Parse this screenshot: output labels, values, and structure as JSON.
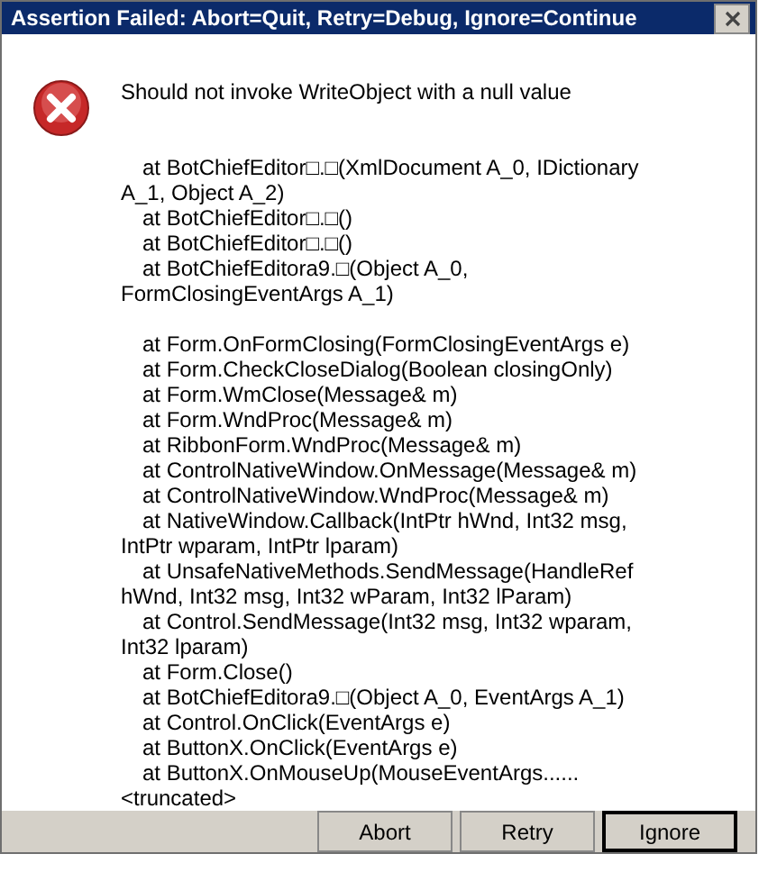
{
  "window": {
    "title": "Assertion Failed: Abort=Quit, Retry=Debug, Ignore=Continue"
  },
  "message": "Should not invoke WriteObject with a null value",
  "stack_groups": [
    [
      "at BotChiefEditor□.□(XmlDocument A_0, IDictionary A_1, Object A_2)",
      "at BotChiefEditor□.□()",
      "at BotChiefEditor□.□()",
      "at BotChiefEditora9.□(Object A_0, FormClosingEventArgs A_1)"
    ],
    [
      "at Form.OnFormClosing(FormClosingEventArgs e)",
      "at Form.CheckCloseDialog(Boolean closingOnly)",
      "at Form.WmClose(Message& m)",
      "at Form.WndProc(Message& m)",
      "at RibbonForm.WndProc(Message& m)",
      "at ControlNativeWindow.OnMessage(Message& m)",
      "at ControlNativeWindow.WndProc(Message& m)",
      "at NativeWindow.Callback(IntPtr hWnd, Int32 msg, IntPtr wparam, IntPtr lparam)",
      "at UnsafeNativeMethods.SendMessage(HandleRef hWnd, Int32 msg, Int32 wParam, Int32 lParam)",
      "at Control.SendMessage(Int32 msg, Int32 wparam, Int32 lparam)",
      "at Form.Close()",
      "at BotChiefEditora9.□(Object A_0, EventArgs A_1)",
      "at Control.OnClick(EventArgs e)",
      "at ButtonX.OnClick(EventArgs e)",
      "at ButtonX.OnMouseUp(MouseEventArgs......"
    ]
  ],
  "truncated_note": "<truncated>",
  "buttons": [
    {
      "label": "Abort",
      "selected": false
    },
    {
      "label": "Retry",
      "selected": false
    },
    {
      "label": "Ignore",
      "selected": true
    }
  ]
}
